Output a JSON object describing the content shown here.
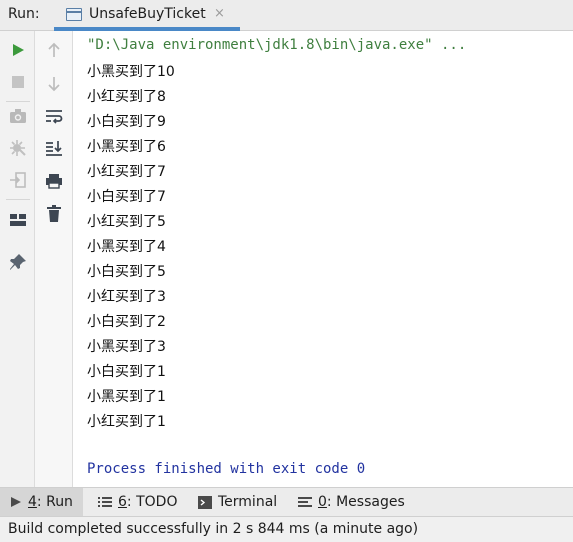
{
  "header": {
    "run_label": "Run:",
    "tab_title": "UnsafeBuyTicket",
    "tab_close": "×"
  },
  "console": {
    "command": "\"D:\\Java environment\\jdk1.8\\bin\\java.exe\" ...",
    "lines": [
      "小黑买到了10",
      "小红买到了8",
      "小白买到了9",
      "小黑买到了6",
      "小红买到了7",
      "小白买到了7",
      "小红买到了5",
      "小黑买到了4",
      "小白买到了5",
      "小红买到了3",
      "小白买到了2",
      "小黑买到了3",
      "小白买到了1",
      "小黑买到了1",
      "小红买到了1"
    ],
    "finish": "Process finished with exit code 0"
  },
  "bottom_tabs": [
    {
      "key": "4",
      "label": ": Run"
    },
    {
      "key": "6",
      "label": ": TODO"
    },
    {
      "key": "",
      "label": "Terminal"
    },
    {
      "key": "0",
      "label": ": Messages"
    }
  ],
  "status": {
    "text": "Build completed successfully in 2 s 844 ms (a minute ago)"
  },
  "colors": {
    "accent": "#4a88c7",
    "run_green": "#3c9a3c",
    "command_text": "#3f7f3f",
    "finish_text": "#2233a0"
  }
}
